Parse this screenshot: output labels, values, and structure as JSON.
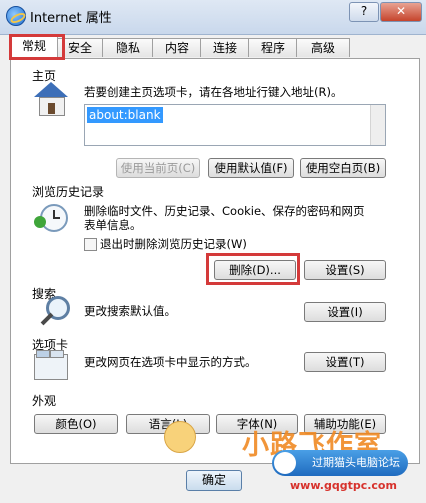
{
  "window": {
    "title": "Internet 属性",
    "help_label": "?",
    "close_label": "✕"
  },
  "tabs": [
    "常规",
    "安全",
    "隐私",
    "内容",
    "连接",
    "程序",
    "高级"
  ],
  "homepage": {
    "title": "主页",
    "description": "若要创建主页选项卡，请在各地址行键入地址(R)。",
    "address_value": "about:blank",
    "use_current_label": "使用当前页(C)",
    "use_default_label": "使用默认值(F)",
    "use_blank_label": "使用空白页(B)"
  },
  "history": {
    "title": "浏览历史记录",
    "description_line1": "删除临时文件、历史记录、Cookie、保存的密码和网页",
    "description_line2": "表单信息。",
    "checkbox_label": "退出时删除浏览历史记录(W)",
    "delete_label": "删除(D)...",
    "settings_label": "设置(S)"
  },
  "search": {
    "title": "搜索",
    "description": "更改搜索默认值。",
    "settings_label": "设置(I)"
  },
  "tabsection": {
    "title": "选项卡",
    "description": "更改网页在选项卡中显示的方式。",
    "settings_label": "设置(T)"
  },
  "appearance": {
    "title": "外观",
    "colors_label": "颜色(O)",
    "languages_label": "语言(L)",
    "fonts_label": "字体(N)",
    "accessibility_label": "辅助功能(E)"
  },
  "footer": {
    "ok_label": "确定"
  },
  "overlay": {
    "logo_text": "小路飞作室",
    "forum_text": "过期猫头电脑论坛",
    "site_text": "www.gqgtpc.com"
  }
}
